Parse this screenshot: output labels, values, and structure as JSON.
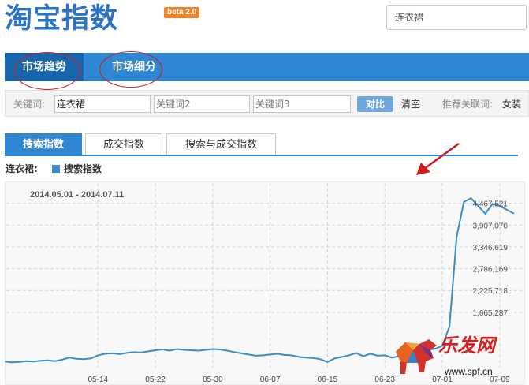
{
  "header": {
    "logo_text": "淘宝指数",
    "beta_badge": "beta 2.0",
    "search_value": "连衣裙"
  },
  "nav": {
    "items": [
      {
        "label": "市场趋势",
        "active": true
      },
      {
        "label": "市场细分",
        "active": false
      }
    ]
  },
  "keywords": {
    "label": "关键词:",
    "kw1_value": "连衣裙",
    "kw2_placeholder": "关键词2",
    "kw3_placeholder": "关键词3",
    "compare_label": "对比",
    "clear_label": "清空",
    "recommend_label": "推荐关联词:",
    "recommend_item": "女装"
  },
  "tabs": [
    {
      "label": "搜索指数",
      "active": true
    },
    {
      "label": "成交指数",
      "active": false
    },
    {
      "label": "搜索与成交指数",
      "active": false
    }
  ],
  "legend": {
    "series_name": "连衣裙:",
    "series_label": "搜索指数"
  },
  "chart_data": {
    "type": "line",
    "date_range": "2014.05.01 - 2014.07.11",
    "x_ticks": [
      "05-14",
      "05-22",
      "05-30",
      "06-07",
      "06-15",
      "06-23",
      "07-01",
      "07-09"
    ],
    "y_ticks": [
      "1,665,287",
      "2,225,718",
      "2,786,169",
      "3,346,619",
      "3,907,070",
      "4,467,521"
    ],
    "partial_y_tick": ",8",
    "ylim": [
      0,
      5028000
    ],
    "grid": true,
    "series": [
      {
        "color": "#3d8bc9",
        "x": [
          "05-01",
          "05-02",
          "05-03",
          "05-04",
          "05-05",
          "05-06",
          "05-07",
          "05-08",
          "05-09",
          "05-10",
          "05-11",
          "05-12",
          "05-13",
          "05-14",
          "05-15",
          "05-16",
          "05-17",
          "05-18",
          "05-19",
          "05-20",
          "05-21",
          "05-22",
          "05-23",
          "05-24",
          "05-25",
          "05-26",
          "05-27",
          "05-28",
          "05-29",
          "05-30",
          "05-31",
          "06-01",
          "06-02",
          "06-03",
          "06-04",
          "06-05",
          "06-06",
          "06-07",
          "06-08",
          "06-09",
          "06-10",
          "06-11",
          "06-12",
          "06-13",
          "06-14",
          "06-15",
          "06-16",
          "06-17",
          "06-18",
          "06-19",
          "06-20",
          "06-21",
          "06-22",
          "06-23",
          "06-24",
          "06-25",
          "06-26",
          "06-27",
          "06-28",
          "06-29",
          "06-30",
          "07-01",
          "07-02",
          "07-03",
          "07-04",
          "07-05",
          "07-06",
          "07-07",
          "07-08",
          "07-09",
          "07-10",
          "07-11"
        ],
        "values": [
          400000,
          380000,
          390000,
          410000,
          400000,
          420000,
          430000,
          410000,
          450000,
          500000,
          470000,
          460000,
          480000,
          560000,
          600000,
          610000,
          590000,
          620000,
          640000,
          630000,
          660000,
          690000,
          710000,
          680000,
          720000,
          700000,
          690000,
          680000,
          700000,
          720000,
          710000,
          680000,
          640000,
          610000,
          580000,
          550000,
          560000,
          580000,
          600000,
          570000,
          560000,
          520000,
          500000,
          490000,
          460000,
          390000,
          480000,
          520000,
          560000,
          620000,
          540000,
          600000,
          550000,
          560000,
          500000,
          540000,
          700000,
          720000,
          710000,
          700000,
          730000,
          800000,
          1300000,
          3600000,
          4500000,
          4600000,
          4400000,
          4200000,
          4450000,
          4400000,
          4300000,
          4200000
        ]
      }
    ]
  }
}
